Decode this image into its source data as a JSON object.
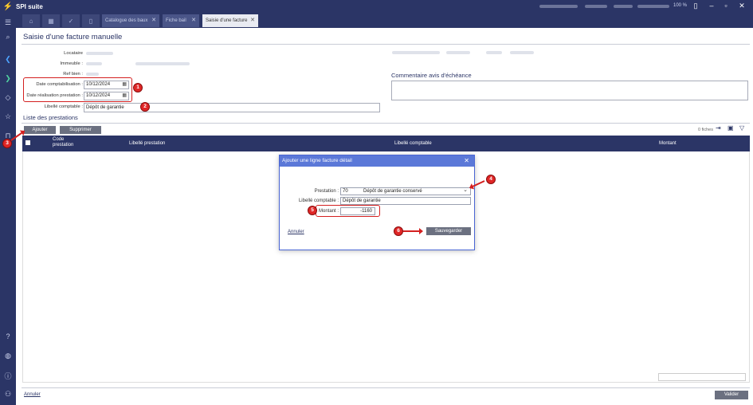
{
  "app": {
    "name": "SPI suite",
    "zoom": "100 %"
  },
  "tabs": [
    {
      "label": "Catalogue des baux"
    },
    {
      "label": "Fiche bail"
    },
    {
      "label": "Saisie d'une facture"
    }
  ],
  "page": {
    "title": "Saisie d'une facture manuelle"
  },
  "form": {
    "locataire_label": "Locataire",
    "immeuble_label": "Immeuble :",
    "refbien_label": "Ref bien :",
    "date_compta_label": "Date comptabilisation :",
    "date_compta_value": "10/12/2024",
    "date_real_label": "Date réalisation prestation :",
    "date_real_value": "10/12/2024",
    "libelle_label": "Libellé comptable :",
    "libelle_value": "Dépôt de garantie"
  },
  "comment": {
    "title": "Commentaire avis d'échéance"
  },
  "prestations": {
    "title": "Liste des prestations",
    "add_label": "Ajouter",
    "delete_label": "Supprimer",
    "count_label": "0 fiches",
    "columns": [
      "Code prestation",
      "Libellé prestation",
      "Libellé comptable",
      "Montant"
    ]
  },
  "dialog": {
    "title": "Ajouter une ligne facture détail",
    "prestation_label": "Prestation :",
    "prestation_code": "70",
    "prestation_desc": "Dépôt de garantie conservé",
    "libelle_label": "Libellé comptable :",
    "libelle_value": "Dépôt de garantie",
    "montant_label": "Montant :",
    "montant_value": "-1160",
    "cancel_label": "Annuler",
    "save_label": "Sauvegarder"
  },
  "footer": {
    "cancel_label": "Annuler",
    "validate_label": "Valider"
  },
  "annotations": [
    "1",
    "2",
    "3",
    "4",
    "5",
    "6"
  ],
  "colors": {
    "navy": "#2b3566",
    "annotation_red": "#e02626",
    "dialog_blue": "#5b78d8"
  }
}
